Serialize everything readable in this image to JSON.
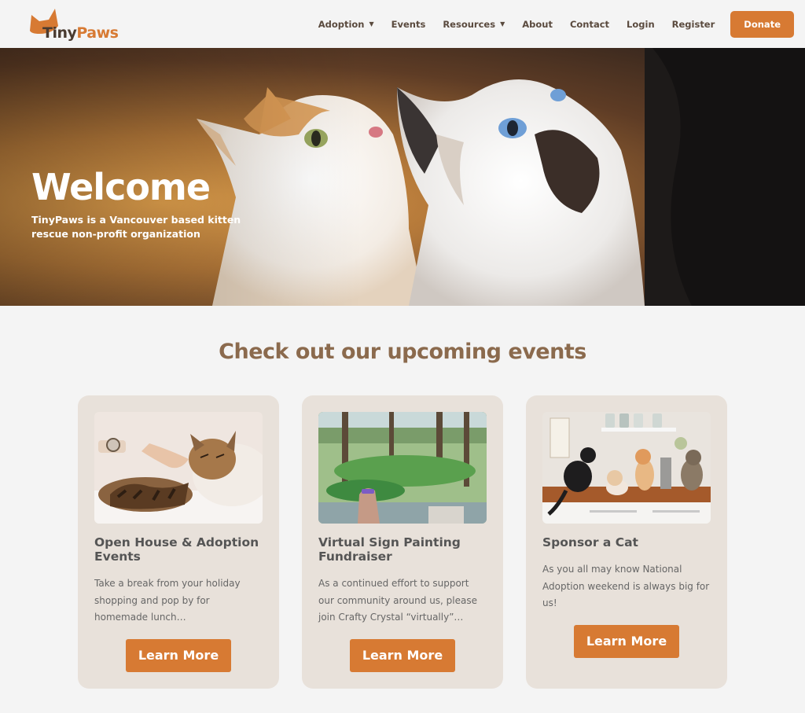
{
  "brand": {
    "name_part1": "Tiny",
    "name_part2": "Paws"
  },
  "nav": {
    "adoption": "Adoption",
    "events": "Events",
    "resources": "Resources",
    "about": "About",
    "contact": "Contact",
    "login": "Login",
    "register": "Register",
    "donate": "Donate"
  },
  "hero": {
    "title": "Welcome",
    "subtitle": "TinyPaws is a Vancouver based kitten rescue non-profit organization"
  },
  "events": {
    "heading": "Check out our upcoming events",
    "cards": [
      {
        "title": "Open House & Adoption Events",
        "description": "Take a break from your holiday shopping and pop by for homemade lunch…",
        "button": "Learn More"
      },
      {
        "title": "Virtual Sign Painting Fundraiser",
        "description": "As a continued effort to support our community around us, please join Crafty Crystal “virtually”…",
        "button": "Learn More"
      },
      {
        "title": "Sponsor a Cat",
        "description": "As you all may know National Adoption weekend is always big for us!",
        "button": "Learn More"
      }
    ]
  },
  "colors": {
    "accent": "#d77a33",
    "heading_brown": "#8b6a4d",
    "card_bg": "#e8e1da"
  }
}
